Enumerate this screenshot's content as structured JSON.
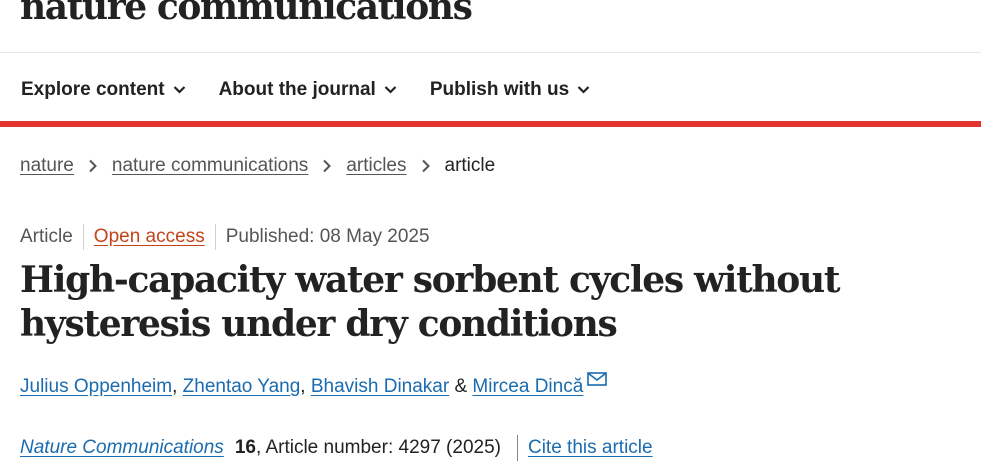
{
  "header": {
    "logo": "nature communications",
    "nav": [
      {
        "label": "Explore content"
      },
      {
        "label": "About the journal"
      },
      {
        "label": "Publish with us"
      }
    ]
  },
  "breadcrumb": {
    "items": [
      "nature",
      "nature communications",
      "articles"
    ],
    "current": "article"
  },
  "meta": {
    "type": "Article",
    "access": "Open access",
    "published": "Published: 08 May 2025"
  },
  "article": {
    "title": "High-capacity water sorbent cycles without hysteresis under dry conditions",
    "authors": [
      "Julius Oppenheim",
      "Zhentao Yang",
      "Bhavish Dinakar",
      "Mircea Dincă"
    ],
    "author_sep": ", ",
    "author_last_sep": " & "
  },
  "citation": {
    "journal": "Nature Communications",
    "volume": "16",
    "rest": ", Article number: 4297 (2025)",
    "cite_label": "Cite this article"
  },
  "colors": {
    "accent_red": "#e3342f",
    "link_blue": "#1a6bb0",
    "open_access": "#c4441a"
  }
}
